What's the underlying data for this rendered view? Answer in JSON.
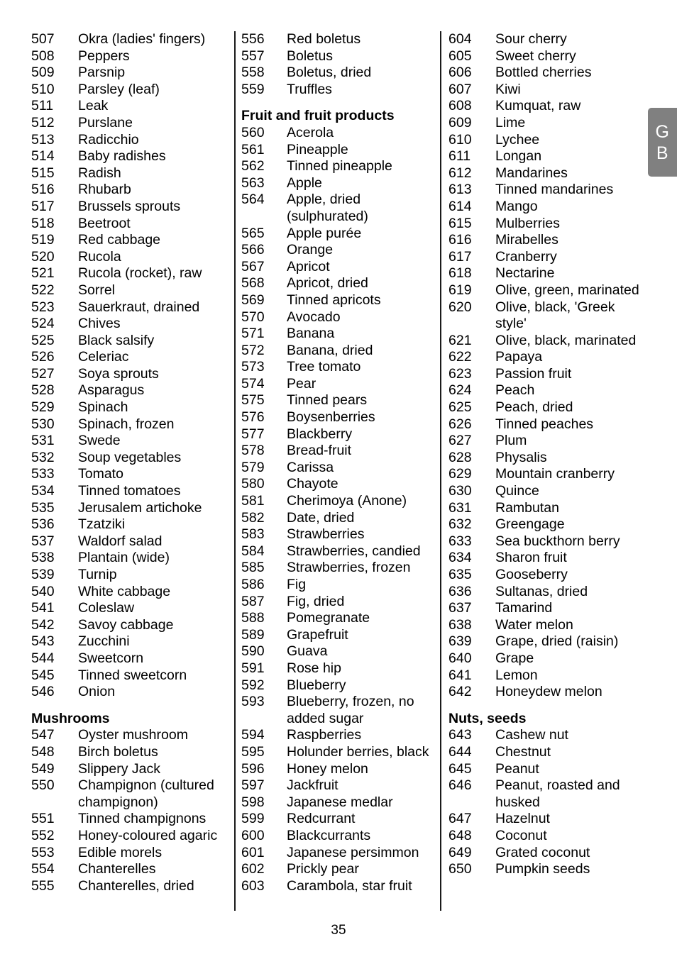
{
  "page": {
    "number": "35",
    "side_tab": {
      "line1": "G",
      "line2": "B",
      "color": "#808080",
      "text_color": "#ffffff"
    }
  },
  "columns": [
    {
      "blocks": [
        {
          "type": "entries",
          "items": [
            {
              "num": "507",
              "label": "Okra (ladies' fingers)"
            },
            {
              "num": "508",
              "label": "Peppers"
            },
            {
              "num": "509",
              "label": "Parsnip"
            },
            {
              "num": "510",
              "label": "Parsley (leaf)"
            },
            {
              "num": "511",
              "label": "Leak"
            },
            {
              "num": "512",
              "label": "Purslane"
            },
            {
              "num": "513",
              "label": "Radicchio"
            },
            {
              "num": "514",
              "label": "Baby radishes"
            },
            {
              "num": "515",
              "label": "Radish"
            },
            {
              "num": "516",
              "label": "Rhubarb"
            },
            {
              "num": "517",
              "label": "Brussels sprouts"
            },
            {
              "num": "518",
              "label": "Beetroot"
            },
            {
              "num": "519",
              "label": "Red cabbage"
            },
            {
              "num": "520",
              "label": "Rucola"
            },
            {
              "num": "521",
              "label": "Rucola (rocket), raw"
            },
            {
              "num": "522",
              "label": "Sorrel"
            },
            {
              "num": "523",
              "label": "Sauerkraut, drained"
            },
            {
              "num": "524",
              "label": "Chives"
            },
            {
              "num": "525",
              "label": "Black salsify"
            },
            {
              "num": "526",
              "label": "Celeriac"
            },
            {
              "num": "527",
              "label": "Soya sprouts"
            },
            {
              "num": "528",
              "label": "Asparagus"
            },
            {
              "num": "529",
              "label": "Spinach"
            },
            {
              "num": "530",
              "label": "Spinach, frozen"
            },
            {
              "num": "531",
              "label": "Swede"
            },
            {
              "num": "532",
              "label": "Soup vegetables"
            },
            {
              "num": "533",
              "label": "Tomato"
            },
            {
              "num": "534",
              "label": "Tinned tomatoes"
            },
            {
              "num": "535",
              "label": "Jerusalem artichoke"
            },
            {
              "num": "536",
              "label": "Tzatziki"
            },
            {
              "num": "537",
              "label": "Waldorf salad"
            },
            {
              "num": "538",
              "label": "Plantain (wide)"
            },
            {
              "num": "539",
              "label": "Turnip"
            },
            {
              "num": "540",
              "label": "White cabbage"
            },
            {
              "num": "541",
              "label": "Coleslaw"
            },
            {
              "num": "542",
              "label": "Savoy cabbage"
            },
            {
              "num": "543",
              "label": "Zucchini"
            },
            {
              "num": "544",
              "label": "Sweetcorn"
            },
            {
              "num": "545",
              "label": "Tinned sweetcorn"
            },
            {
              "num": "546",
              "label": "Onion"
            }
          ]
        },
        {
          "type": "heading",
          "text": "Mushrooms"
        },
        {
          "type": "entries",
          "items": [
            {
              "num": "547",
              "label": "Oyster mushroom"
            },
            {
              "num": "548",
              "label": "Birch boletus"
            },
            {
              "num": "549",
              "label": "Slippery Jack"
            },
            {
              "num": "550",
              "label": "Champignon (cultured champignon)"
            },
            {
              "num": "551",
              "label": "Tinned champignons"
            },
            {
              "num": "552",
              "label": "Honey-coloured agaric"
            },
            {
              "num": "553",
              "label": "Edible morels"
            },
            {
              "num": "554",
              "label": "Chanterelles"
            },
            {
              "num": "555",
              "label": "Chanterelles, dried"
            }
          ]
        }
      ]
    },
    {
      "blocks": [
        {
          "type": "entries",
          "items": [
            {
              "num": "556",
              "label": "Red boletus"
            },
            {
              "num": "557",
              "label": "Boletus"
            },
            {
              "num": "558",
              "label": "Boletus, dried"
            },
            {
              "num": "559",
              "label": "Truffles"
            }
          ]
        },
        {
          "type": "heading",
          "text": "Fruit and fruit products"
        },
        {
          "type": "entries",
          "items": [
            {
              "num": "560",
              "label": "Acerola"
            },
            {
              "num": "561",
              "label": "Pineapple"
            },
            {
              "num": "562",
              "label": "Tinned pineapple"
            },
            {
              "num": "563",
              "label": "Apple"
            },
            {
              "num": "564",
              "label": "Apple, dried (sulphurated)"
            },
            {
              "num": "565",
              "label": "Apple purée"
            },
            {
              "num": "566",
              "label": "Orange"
            },
            {
              "num": "567",
              "label": "Apricot"
            },
            {
              "num": "568",
              "label": "Apricot, dried"
            },
            {
              "num": "569",
              "label": "Tinned apricots"
            },
            {
              "num": "570",
              "label": "Avocado"
            },
            {
              "num": "571",
              "label": "Banana"
            },
            {
              "num": "572",
              "label": "Banana, dried"
            },
            {
              "num": "573",
              "label": "Tree tomato"
            },
            {
              "num": "574",
              "label": "Pear"
            },
            {
              "num": "575",
              "label": "Tinned pears"
            },
            {
              "num": "576",
              "label": "Boysenberries"
            },
            {
              "num": "577",
              "label": "Blackberry"
            },
            {
              "num": "578",
              "label": "Bread-fruit"
            },
            {
              "num": "579",
              "label": "Carissa"
            },
            {
              "num": "580",
              "label": "Chayote"
            },
            {
              "num": "581",
              "label": "Cherimoya (Anone)"
            },
            {
              "num": "582",
              "label": "Date, dried"
            },
            {
              "num": "583",
              "label": "Strawberries"
            },
            {
              "num": "584",
              "label": "Strawberries, candied"
            },
            {
              "num": "585",
              "label": "Strawberries, frozen"
            },
            {
              "num": "586",
              "label": "Fig"
            },
            {
              "num": "587",
              "label": "Fig, dried"
            },
            {
              "num": "588",
              "label": "Pomegranate"
            },
            {
              "num": "589",
              "label": "Grapefruit"
            },
            {
              "num": "590",
              "label": "Guava"
            },
            {
              "num": "591",
              "label": "Rose hip"
            },
            {
              "num": "592",
              "label": "Blueberry"
            },
            {
              "num": "593",
              "label": "Blueberry, frozen, no added sugar"
            },
            {
              "num": "594",
              "label": "Raspberries"
            },
            {
              "num": "595",
              "label": "Holunder berries, black"
            },
            {
              "num": "596",
              "label": "Honey melon"
            },
            {
              "num": "597",
              "label": "Jackfruit"
            },
            {
              "num": "598",
              "label": "Japanese medlar"
            },
            {
              "num": "599",
              "label": "Redcurrant"
            },
            {
              "num": "600",
              "label": "Blackcurrants"
            },
            {
              "num": "601",
              "label": "Japanese persimmon"
            },
            {
              "num": "602",
              "label": "Prickly pear"
            },
            {
              "num": "603",
              "label": "Carambola, star fruit"
            }
          ]
        }
      ]
    },
    {
      "blocks": [
        {
          "type": "entries",
          "items": [
            {
              "num": "604",
              "label": "Sour cherry"
            },
            {
              "num": "605",
              "label": "Sweet cherry"
            },
            {
              "num": "606",
              "label": "Bottled cherries"
            },
            {
              "num": "607",
              "label": "Kiwi"
            },
            {
              "num": "608",
              "label": "Kumquat, raw"
            },
            {
              "num": "609",
              "label": "Lime"
            },
            {
              "num": "610",
              "label": "Lychee"
            },
            {
              "num": "611",
              "label": "Longan"
            },
            {
              "num": "612",
              "label": "Mandarines"
            },
            {
              "num": "613",
              "label": "Tinned mandarines"
            },
            {
              "num": "614",
              "label": "Mango"
            },
            {
              "num": "615",
              "label": "Mulberries"
            },
            {
              "num": "616",
              "label": "Mirabelles"
            },
            {
              "num": "617",
              "label": "Cranberry"
            },
            {
              "num": "618",
              "label": "Nectarine"
            },
            {
              "num": "619",
              "label": "Olive, green, marinated"
            },
            {
              "num": "620",
              "label": "Olive, black, 'Greek style'"
            },
            {
              "num": "621",
              "label": "Olive, black, marinated"
            },
            {
              "num": "622",
              "label": "Papaya"
            },
            {
              "num": "623",
              "label": "Passion fruit"
            },
            {
              "num": "624",
              "label": "Peach"
            },
            {
              "num": "625",
              "label": "Peach, dried"
            },
            {
              "num": "626",
              "label": "Tinned peaches"
            },
            {
              "num": "627",
              "label": "Plum"
            },
            {
              "num": "628",
              "label": "Physalis"
            },
            {
              "num": "629",
              "label": "Mountain cranberry"
            },
            {
              "num": "630",
              "label": "Quince"
            },
            {
              "num": "631",
              "label": "Rambutan"
            },
            {
              "num": "632",
              "label": "Greengage"
            },
            {
              "num": "633",
              "label": "Sea buckthorn berry"
            },
            {
              "num": "634",
              "label": "Sharon fruit"
            },
            {
              "num": "635",
              "label": "Gooseberry"
            },
            {
              "num": "636",
              "label": "Sultanas, dried"
            },
            {
              "num": "637",
              "label": "Tamarind"
            },
            {
              "num": "638",
              "label": "Water melon"
            },
            {
              "num": "639",
              "label": "Grape, dried (raisin)"
            },
            {
              "num": "640",
              "label": "Grape"
            },
            {
              "num": "641",
              "label": "Lemon"
            },
            {
              "num": "642",
              "label": "Honeydew melon"
            }
          ]
        },
        {
          "type": "heading",
          "text": "Nuts, seeds"
        },
        {
          "type": "entries",
          "items": [
            {
              "num": "643",
              "label": "Cashew nut"
            },
            {
              "num": "644",
              "label": "Chestnut"
            },
            {
              "num": "645",
              "label": "Peanut"
            },
            {
              "num": "646",
              "label": "Peanut, roasted and husked"
            },
            {
              "num": "647",
              "label": "Hazelnut"
            },
            {
              "num": "648",
              "label": "Coconut"
            },
            {
              "num": "649",
              "label": "Grated coconut"
            },
            {
              "num": "650",
              "label": "Pumpkin seeds"
            }
          ]
        }
      ]
    }
  ]
}
